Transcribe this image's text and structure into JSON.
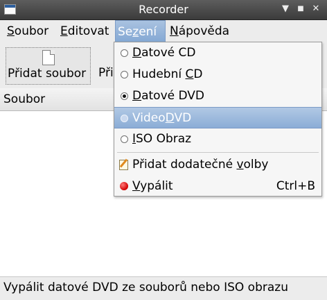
{
  "window": {
    "title": "Recorder"
  },
  "menubar": {
    "items": [
      {
        "pre": "",
        "mn": "S",
        "post": "oubor"
      },
      {
        "pre": "",
        "mn": "E",
        "post": "ditovat"
      },
      {
        "pre": "Se",
        "mn": "z",
        "post": "ení"
      },
      {
        "pre": "",
        "mn": "N",
        "post": "ápověda"
      }
    ]
  },
  "toolbar": {
    "add_file": "Přidat  soubor",
    "second_truncated": "Při"
  },
  "list": {
    "column_header": "Soubor"
  },
  "session_menu": {
    "items": [
      {
        "pre": "",
        "mn": "D",
        "post": "atové CD",
        "checked": false
      },
      {
        "pre": "Hudební ",
        "mn": "C",
        "post": "D",
        "checked": false
      },
      {
        "pre": "",
        "mn": "D",
        "post": "atové DVD",
        "checked": true
      },
      {
        "pre": "Video",
        "mn": "D",
        "post": "VD",
        "checked": false
      },
      {
        "pre": "",
        "mn": "I",
        "post": "SO Obraz",
        "checked": false
      }
    ],
    "extra_options": {
      "pre": "Přidat dodatečné ",
      "mn": "v",
      "post": "olby"
    },
    "burn": {
      "pre": "",
      "mn": "V",
      "post": "ypálit",
      "accel": "Ctrl+B"
    }
  },
  "statusbar": {
    "text": "Vypálit datové DVD ze souborů nebo ISO obrazu"
  }
}
